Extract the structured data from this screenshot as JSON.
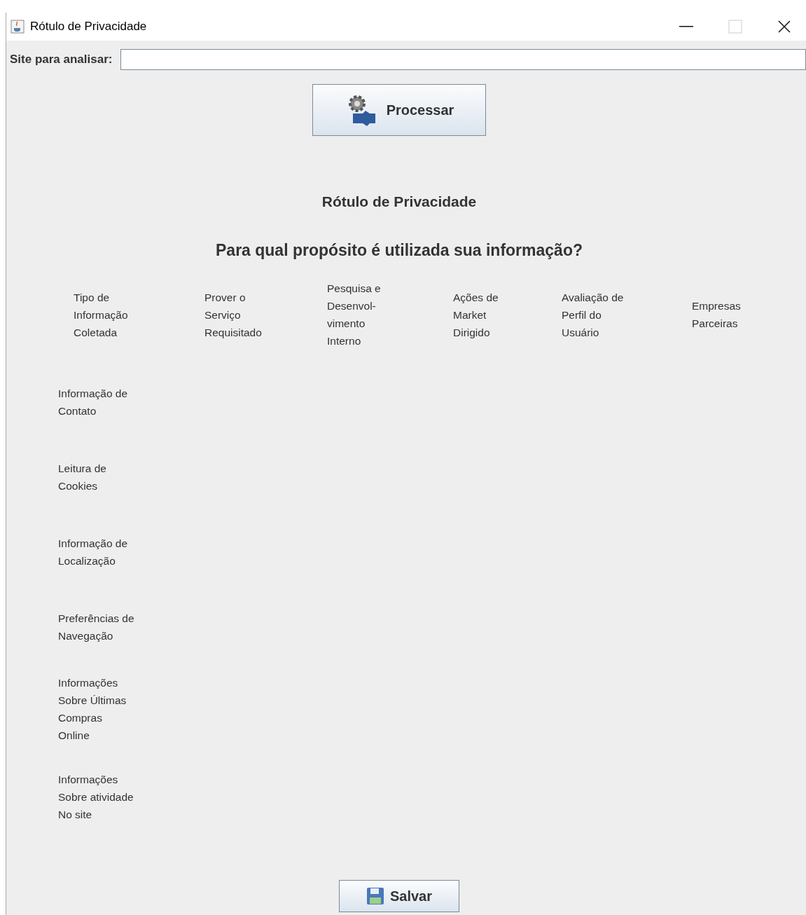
{
  "window": {
    "title": "Rótulo de Privacidade"
  },
  "site_field": {
    "label": "Site para analisar:"
  },
  "process_button": {
    "label": "Processar"
  },
  "label_title": "Rótulo de Privacidade",
  "question": "Para qual propósito é utilizada sua informação?",
  "columns": [
    "Tipo de\nInformação\nColetada",
    "Prover o\nServiço\nRequisitado",
    "Pesquisa e\nDesenvol-\nvimento\nInterno",
    "Ações de\nMarket\nDirigido",
    "Avaliação de\nPerfil do\nUsuário",
    "Empresas\nParceiras"
  ],
  "rows": [
    "Informação de\nContato",
    "Leitura de\nCookies",
    "Informação de\nLocalização",
    "Preferências de\nNavegação",
    "Informações\nSobre Últimas\nCompras\nOnline",
    "Informações\nSobre atividade\nNo site"
  ],
  "save_button": {
    "label": "Salvar"
  }
}
